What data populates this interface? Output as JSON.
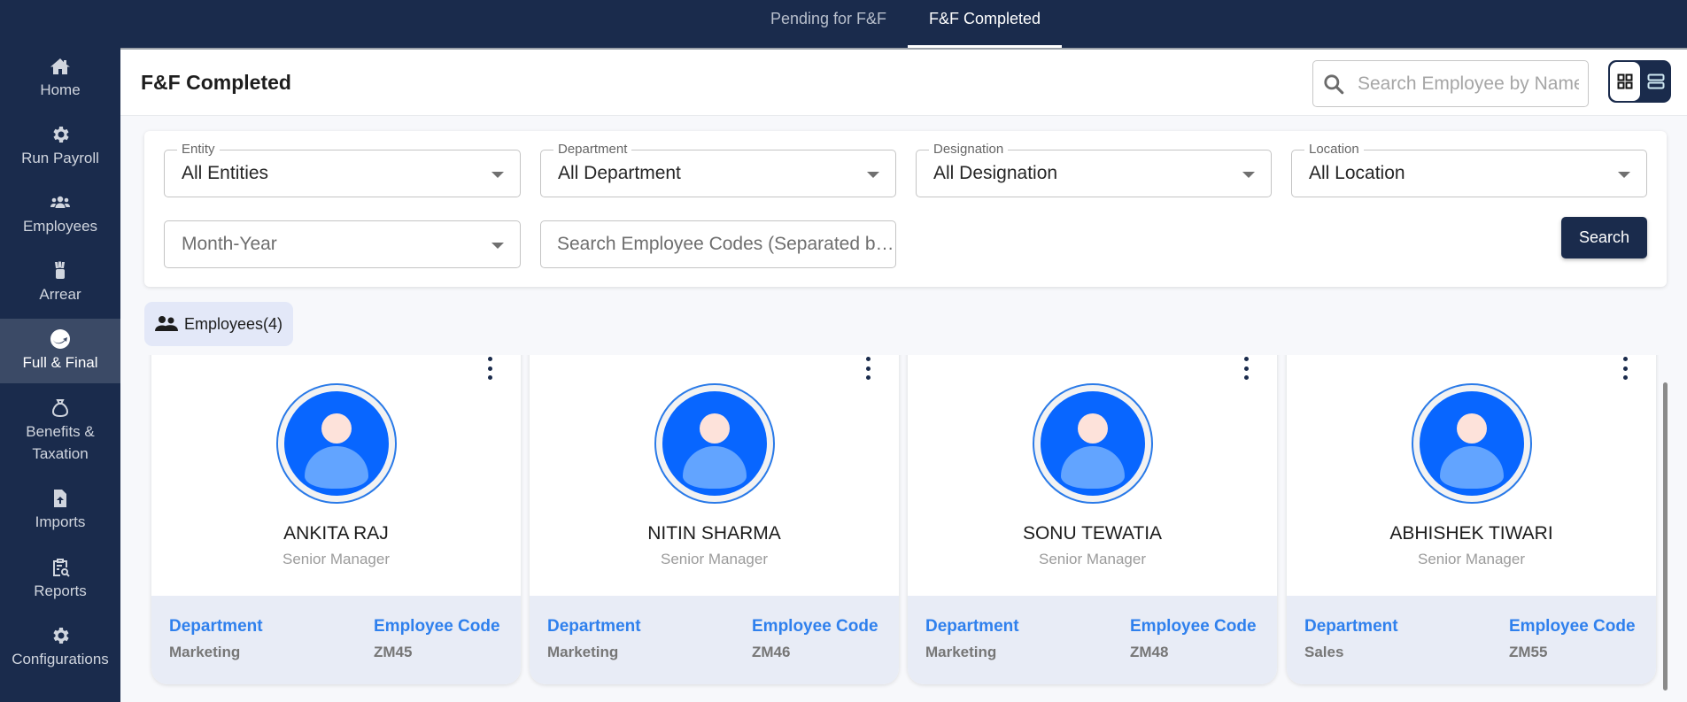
{
  "top_tabs": [
    {
      "label": "Pending for F&F",
      "active": false
    },
    {
      "label": "F&F Completed",
      "active": true
    }
  ],
  "sidebar": {
    "items": [
      {
        "label": "Home",
        "icon": "home-icon",
        "active": false
      },
      {
        "label": "Run Payroll",
        "icon": "gear-icon",
        "active": false
      },
      {
        "label": "Employees",
        "icon": "users-icon",
        "active": false
      },
      {
        "label": "Arrear",
        "icon": "money-hand-icon",
        "active": false
      },
      {
        "label": "Full & Final",
        "icon": "settlement-icon",
        "active": true
      },
      {
        "label": "Benefits & Taxation",
        "icon": "money-bag-icon",
        "active": false
      },
      {
        "label": "Imports",
        "icon": "file-upload-icon",
        "active": false
      },
      {
        "label": "Reports",
        "icon": "report-search-icon",
        "active": false
      },
      {
        "label": "Configurations",
        "icon": "gear-icon",
        "active": false
      }
    ]
  },
  "header": {
    "title": "F&F Completed",
    "search_placeholder": "Search Employee by Name",
    "view_mode": "grid"
  },
  "filters": {
    "entity": {
      "label": "Entity",
      "value": "All Entities"
    },
    "department": {
      "label": "Department",
      "value": "All Department"
    },
    "designation": {
      "label": "Designation",
      "value": "All Designation"
    },
    "location": {
      "label": "Location",
      "value": "All Location"
    },
    "month_year": {
      "placeholder": "Month-Year"
    },
    "employee_codes": {
      "placeholder": "Search Employee Codes (Separated by comma)"
    },
    "search_button": "Search"
  },
  "employees_chip": {
    "label": "Employees(4)"
  },
  "card_labels": {
    "department": "Department",
    "employee_code": "Employee Code"
  },
  "employees": [
    {
      "name": "ANKITA RAJ",
      "designation": "Senior Manager",
      "department": "Marketing",
      "code": "ZM45"
    },
    {
      "name": "NITIN SHARMA",
      "designation": "Senior Manager",
      "department": "Marketing",
      "code": "ZM46"
    },
    {
      "name": "SONU TEWATIA",
      "designation": "Senior Manager",
      "department": "Marketing",
      "code": "ZM48"
    },
    {
      "name": "ABHISHEK TIWARI",
      "designation": "Senior Manager",
      "department": "Sales",
      "code": "ZM55"
    }
  ],
  "colors": {
    "navy": "#1a2b4c",
    "sidebar_active": "#3b4a66",
    "accent_blue": "#2f80ed",
    "avatar_blue": "#0866ff",
    "chip_bg": "#e3e8f8",
    "card_footer_bg": "#e8ecf6"
  }
}
